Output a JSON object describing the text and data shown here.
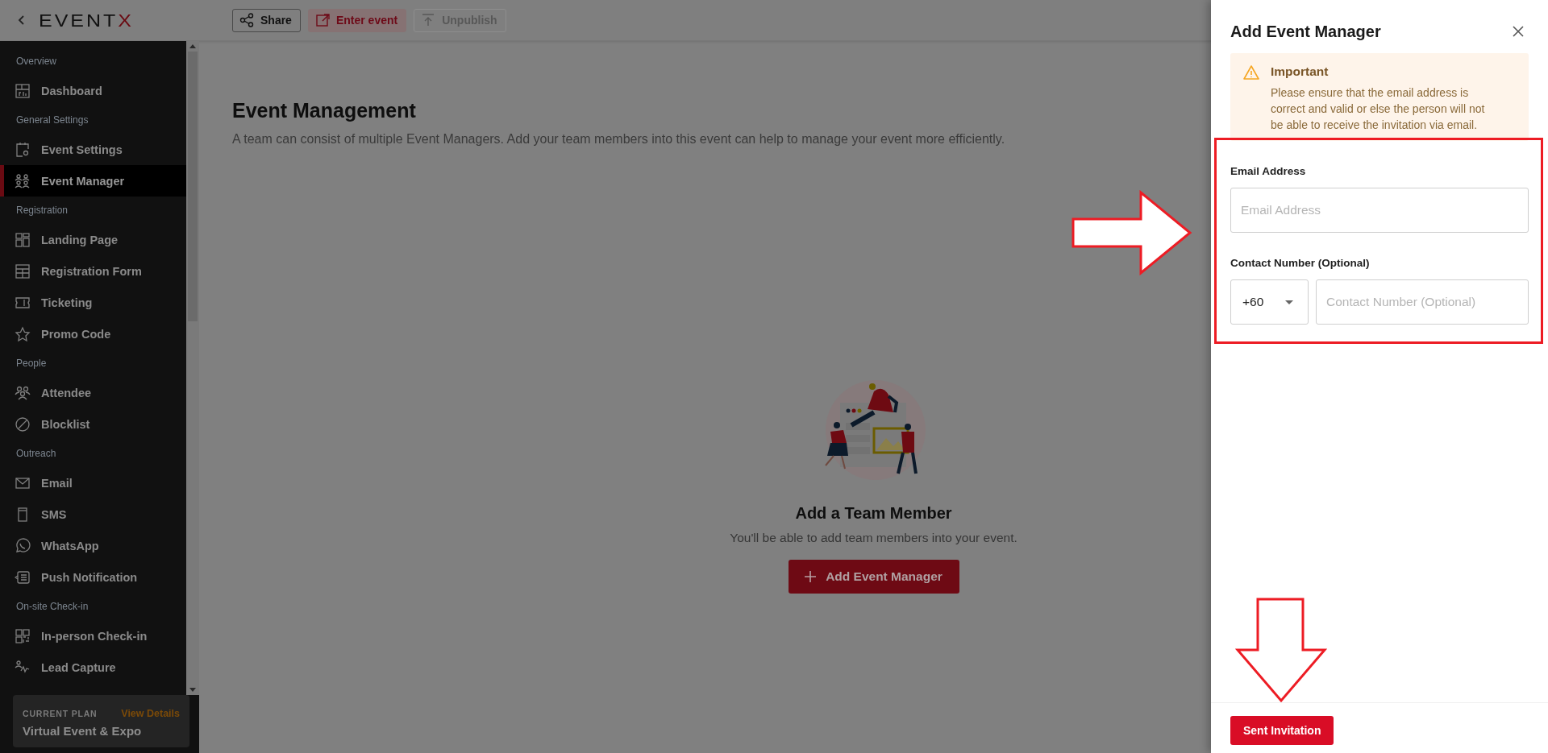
{
  "topbar": {
    "logo_main": "EVENT",
    "logo_accent": "X",
    "buttons": [
      {
        "label": "Share",
        "kind": "outline",
        "disabled": false
      },
      {
        "label": "Enter event",
        "kind": "tinted",
        "disabled": false
      },
      {
        "label": "Unpublish",
        "kind": "outline",
        "disabled": true
      }
    ]
  },
  "sidebar": {
    "sections": [
      {
        "title": "Overview",
        "items": [
          {
            "label": "Dashboard",
            "selected": false
          }
        ]
      },
      {
        "title": "General Settings",
        "items": [
          {
            "label": "Event Settings",
            "selected": false
          },
          {
            "label": "Event Manager",
            "selected": true
          }
        ]
      },
      {
        "title": "Registration",
        "items": [
          {
            "label": "Landing Page",
            "selected": false
          },
          {
            "label": "Registration Form",
            "selected": false
          },
          {
            "label": "Ticketing",
            "selected": false
          },
          {
            "label": "Promo Code",
            "selected": false
          }
        ]
      },
      {
        "title": "People",
        "items": [
          {
            "label": "Attendee",
            "selected": false
          },
          {
            "label": "Blocklist",
            "selected": false
          }
        ]
      },
      {
        "title": "Outreach",
        "items": [
          {
            "label": "Email",
            "selected": false
          },
          {
            "label": "SMS",
            "selected": false
          },
          {
            "label": "WhatsApp",
            "selected": false
          },
          {
            "label": "Push Notification",
            "selected": false
          }
        ]
      },
      {
        "title": "On-site Check-in",
        "items": [
          {
            "label": "In-person Check-in",
            "selected": false
          },
          {
            "label": "Lead Capture",
            "selected": false
          }
        ]
      }
    ],
    "plan": {
      "caption": "CURRENT PLAN",
      "link": "View Details",
      "name": "Virtual Event & Expo"
    }
  },
  "main": {
    "title": "Event Management",
    "description": "A team can consist of multiple Event Managers. Add your team members into this event can help to manage your event more efficiently.",
    "empty_state": {
      "title": "Add a Team Member",
      "text": "You'll be able to add team members into your event.",
      "button": "Add Event Manager"
    }
  },
  "drawer": {
    "title": "Add Event Manager",
    "alert": {
      "title": "Important",
      "text": "Please ensure that the email address is correct and valid or else the person will not be able to receive the invitation via email."
    },
    "email": {
      "label": "Email Address",
      "placeholder": "Email Address"
    },
    "contact": {
      "label": "Contact Number (Optional)",
      "country_code": "+60",
      "placeholder": "Contact Number (Optional)"
    },
    "submit": "Sent Invitation"
  }
}
